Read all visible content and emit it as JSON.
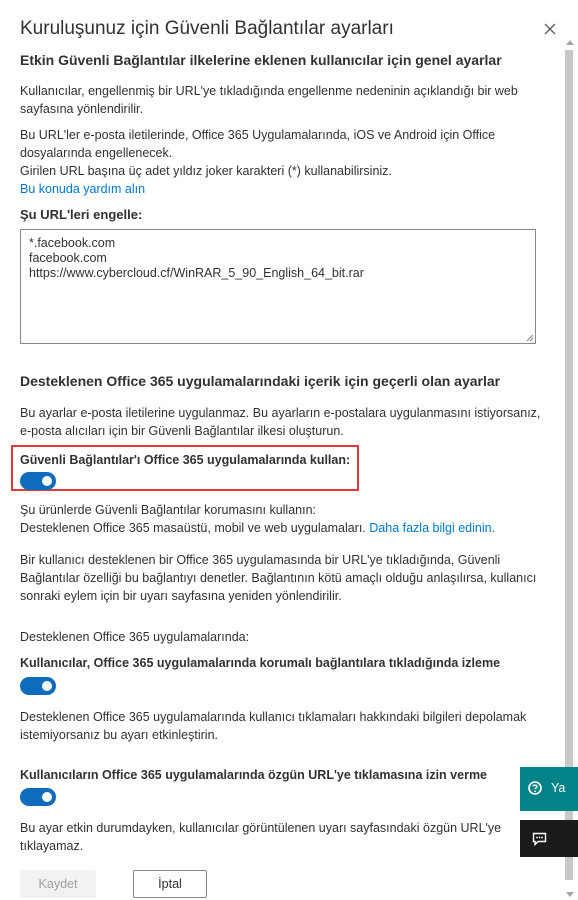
{
  "panel": {
    "title": "Kuruluşunuz için Güvenli Bağlantılar ayarları"
  },
  "general": {
    "heading": "Etkin Güvenli Bağlantılar ilkelerine eklenen kullanıcılar için genel ayarlar",
    "para1_line1": "Kullanıcılar, engellenmiş bir URL'ye tıkladığında engellenme nedeninin açıklandığı bir web",
    "para1_line2": "sayfasına yönlendirilir.",
    "para2_line1": "Bu URL'ler e-posta iletilerinde, Office 365 Uygulamalarında, iOS ve Android için Office",
    "para2_line2": "dosyalarında engellenecek.",
    "para2_line3": "Girilen URL başına üç adet yıldız joker karakteri (*) kullanabilirsiniz.",
    "help_link": "Bu konuda yardım alın"
  },
  "block_urls": {
    "label": "Şu URL'leri engelle:",
    "lines": [
      "*.facebook.com",
      "facebook.com",
      "https://www.cybercloud.cf/WinRAR_5_90_English_64_bit.rar"
    ]
  },
  "office_apps": {
    "heading": "Desteklenen Office 365 uygulamalarındaki içerik için geçerli olan ayarlar",
    "para_line1": "Bu ayarlar e-posta iletilerine uygulanmaz. Bu ayarların e-postalara uygulanmasını istiyorsanız,",
    "para_line2": "e-posta alıcıları için bir Güvenli Bağlantılar ilkesi oluşturun.",
    "toggle1_label": "Güvenli Bağlantılar'ı Office 365 uygulamalarında kullan:",
    "toggle1_on": true,
    "desc1_line1": "Şu ürünlerde Güvenli Bağlantılar korumasını kullanın:",
    "desc1_line2": "Desteklenen Office 365 masaüstü, mobil ve web uygulamaları.",
    "more_info_link": "Daha fazla bilgi edinin.",
    "desc2_line1": "Bir kullanıcı desteklenen bir Office 365 uygulamasında bir URL'ye tıkladığında, Güvenli",
    "desc2_line2": "Bağlantılar özelliği bu bağlantıyı denetler. Bağlantının kötü amaçlı olduğu anlaşılırsa, kullanıcı",
    "desc2_line3": "sonraki eylem için bir uyarı sayfasına yeniden yönlendirilir.",
    "supported_intro": "Desteklenen Office 365 uygulamalarında:",
    "toggle2_label": "Kullanıcılar, Office 365 uygulamalarında korumalı bağlantılara tıkladığında izleme",
    "toggle2_on": true,
    "desc3_line1": "Desteklenen Office 365 uygulamalarında kullanıcı tıklamaları hakkındaki bilgileri depolamak",
    "desc3_line2": "istemiyorsanız bu ayarı etkinleştirin.",
    "toggle3_label": "Kullanıcıların Office 365 uygulamalarında özgün URL'ye tıklamasına izin verme",
    "toggle3_on": true,
    "desc4_line1": "Bu ayar etkin durumdayken, kullanıcılar görüntülenen uyarı sayfasındaki özgün URL'ye",
    "desc4_line2": "tıklayamaz."
  },
  "footer": {
    "save_label": "Kaydet",
    "cancel_label": "İptal"
  },
  "floating": {
    "help_label": "Ya",
    "help_icon": "help-circle-icon",
    "chat_icon": "chat-icon"
  },
  "colors": {
    "toggle_on": "#0f6cbd",
    "link": "#0078d4",
    "highlight": "#e03a3a",
    "help_fab": "#038387"
  }
}
